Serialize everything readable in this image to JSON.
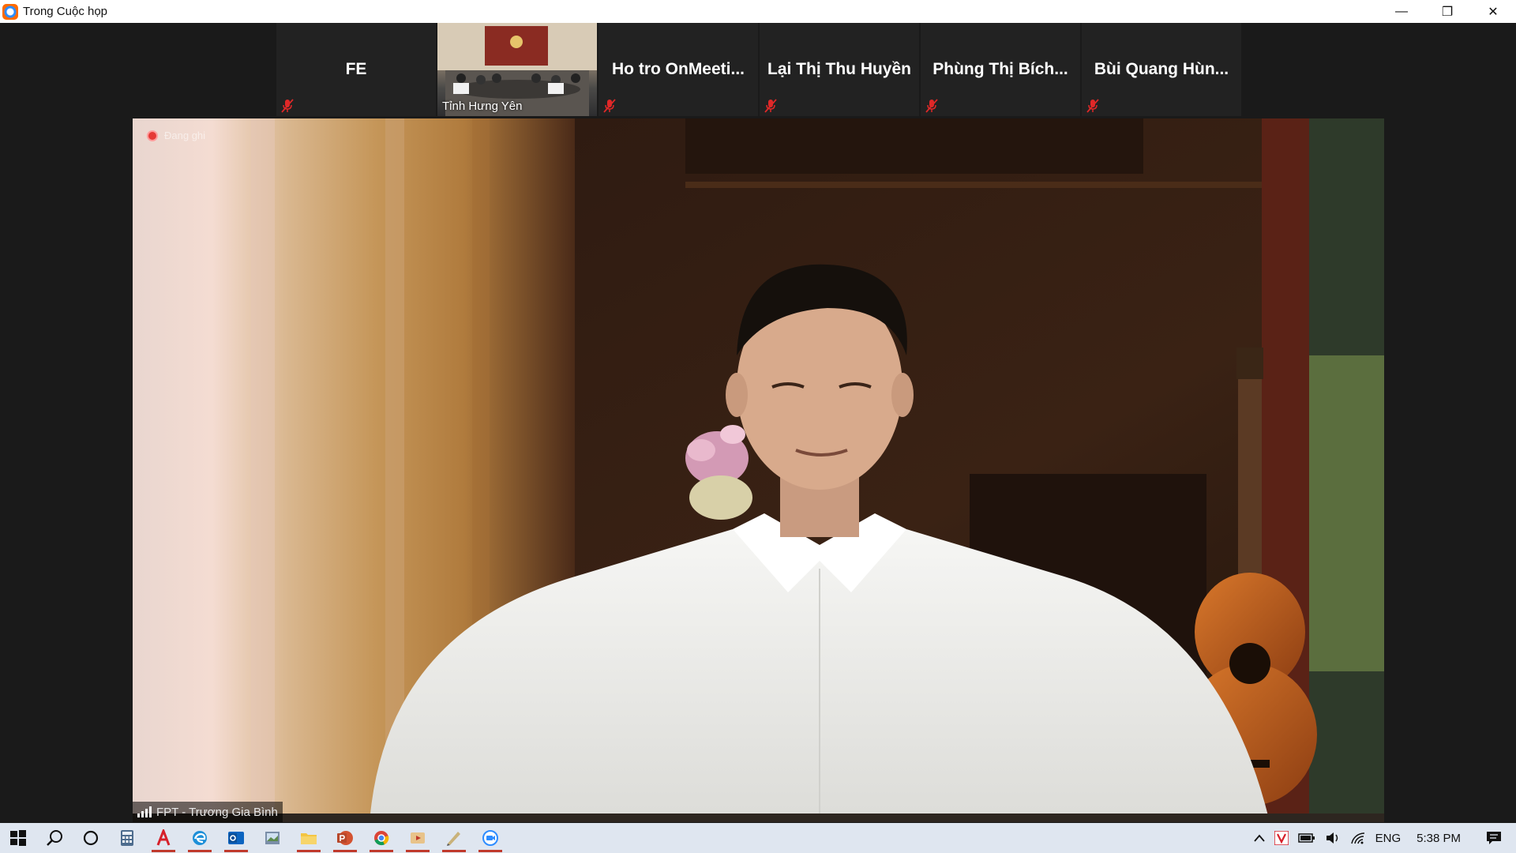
{
  "window": {
    "title": "Trong Cuộc họp",
    "controls": {
      "minimize": "—",
      "restore": "❐",
      "close": "✕"
    }
  },
  "participants": [
    {
      "name": "FE",
      "muted": true,
      "has_video": false
    },
    {
      "name": "Tỉnh Hưng Yên",
      "muted": false,
      "has_video": true
    },
    {
      "name": "Ho tro OnMeeti...",
      "muted": true,
      "has_video": false
    },
    {
      "name": "Lại Thị Thu Huyền",
      "muted": true,
      "has_video": false
    },
    {
      "name": "Phùng Thị Bích...",
      "muted": true,
      "has_video": false
    },
    {
      "name": "Bùi Quang Hùn...",
      "muted": true,
      "has_video": false
    }
  ],
  "main_video": {
    "recording_label": "Đang ghi",
    "speaker_name": "FPT - Trương Gia Bình",
    "signal_icon": "signal-bars-icon"
  },
  "taskbar": {
    "apps": [
      {
        "icon": "windows-start-icon",
        "running": false
      },
      {
        "icon": "search-icon",
        "running": false
      },
      {
        "icon": "cortana-icon",
        "running": false
      },
      {
        "icon": "calculator-icon",
        "running": false
      },
      {
        "icon": "acrobat-icon",
        "running": true
      },
      {
        "icon": "edge-icon",
        "running": true
      },
      {
        "icon": "outlook-icon",
        "running": true
      },
      {
        "icon": "photos-icon",
        "running": false
      },
      {
        "icon": "file-explorer-icon",
        "running": true
      },
      {
        "icon": "powerpoint-icon",
        "running": true
      },
      {
        "icon": "chrome-icon",
        "running": true
      },
      {
        "icon": "media-player-icon",
        "running": true
      },
      {
        "icon": "paint-icon",
        "running": true
      },
      {
        "icon": "zoom-icon",
        "running": true
      }
    ],
    "tray": {
      "language": "ENG",
      "time": "5:38 PM"
    }
  },
  "colors": {
    "meeting_bg": "#1a1a1a",
    "tile_bg": "#222222",
    "mute_red": "#e02828",
    "taskbar_bg": "#dfe6f0",
    "running_indicator": "#c0392b"
  }
}
